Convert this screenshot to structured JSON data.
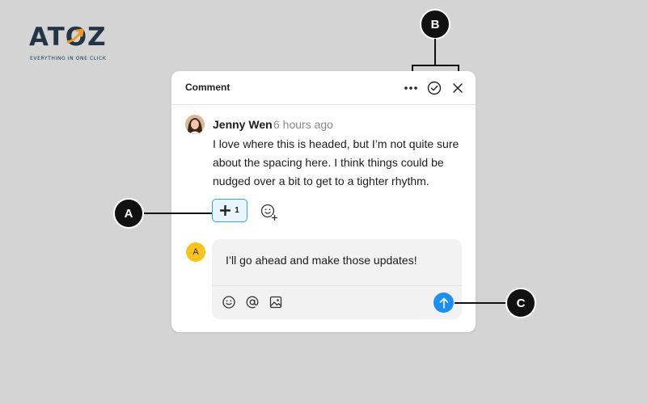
{
  "logo": {
    "word": "ATOZ",
    "tagline": "EVERYTHING IN ONE CLICK"
  },
  "comment_panel": {
    "title": "Comment",
    "comment": {
      "author": "Jenny Wen",
      "time": "6 hours ago",
      "text": "I love where this is headed, but I’m not quite sure about the spacing here. I think things could be nudged over a bit to get to a tighter rhythm.",
      "reaction_count": "1"
    },
    "reply": {
      "avatar_initial": "A",
      "text": "I’ll go ahead and make those updates!"
    }
  },
  "callouts": {
    "a": "A",
    "b": "B",
    "c": "C"
  },
  "colors": {
    "accent": "#1b8ff2",
    "reaction_border": "#36a4e6",
    "avatar_yellow": "#f7c31c",
    "callout": "#111111"
  },
  "icons": [
    "more-icon",
    "resolve-check-icon",
    "close-icon",
    "plus-icon",
    "add-reaction-icon",
    "emoji-icon",
    "mention-icon",
    "image-icon",
    "send-arrow-icon"
  ]
}
